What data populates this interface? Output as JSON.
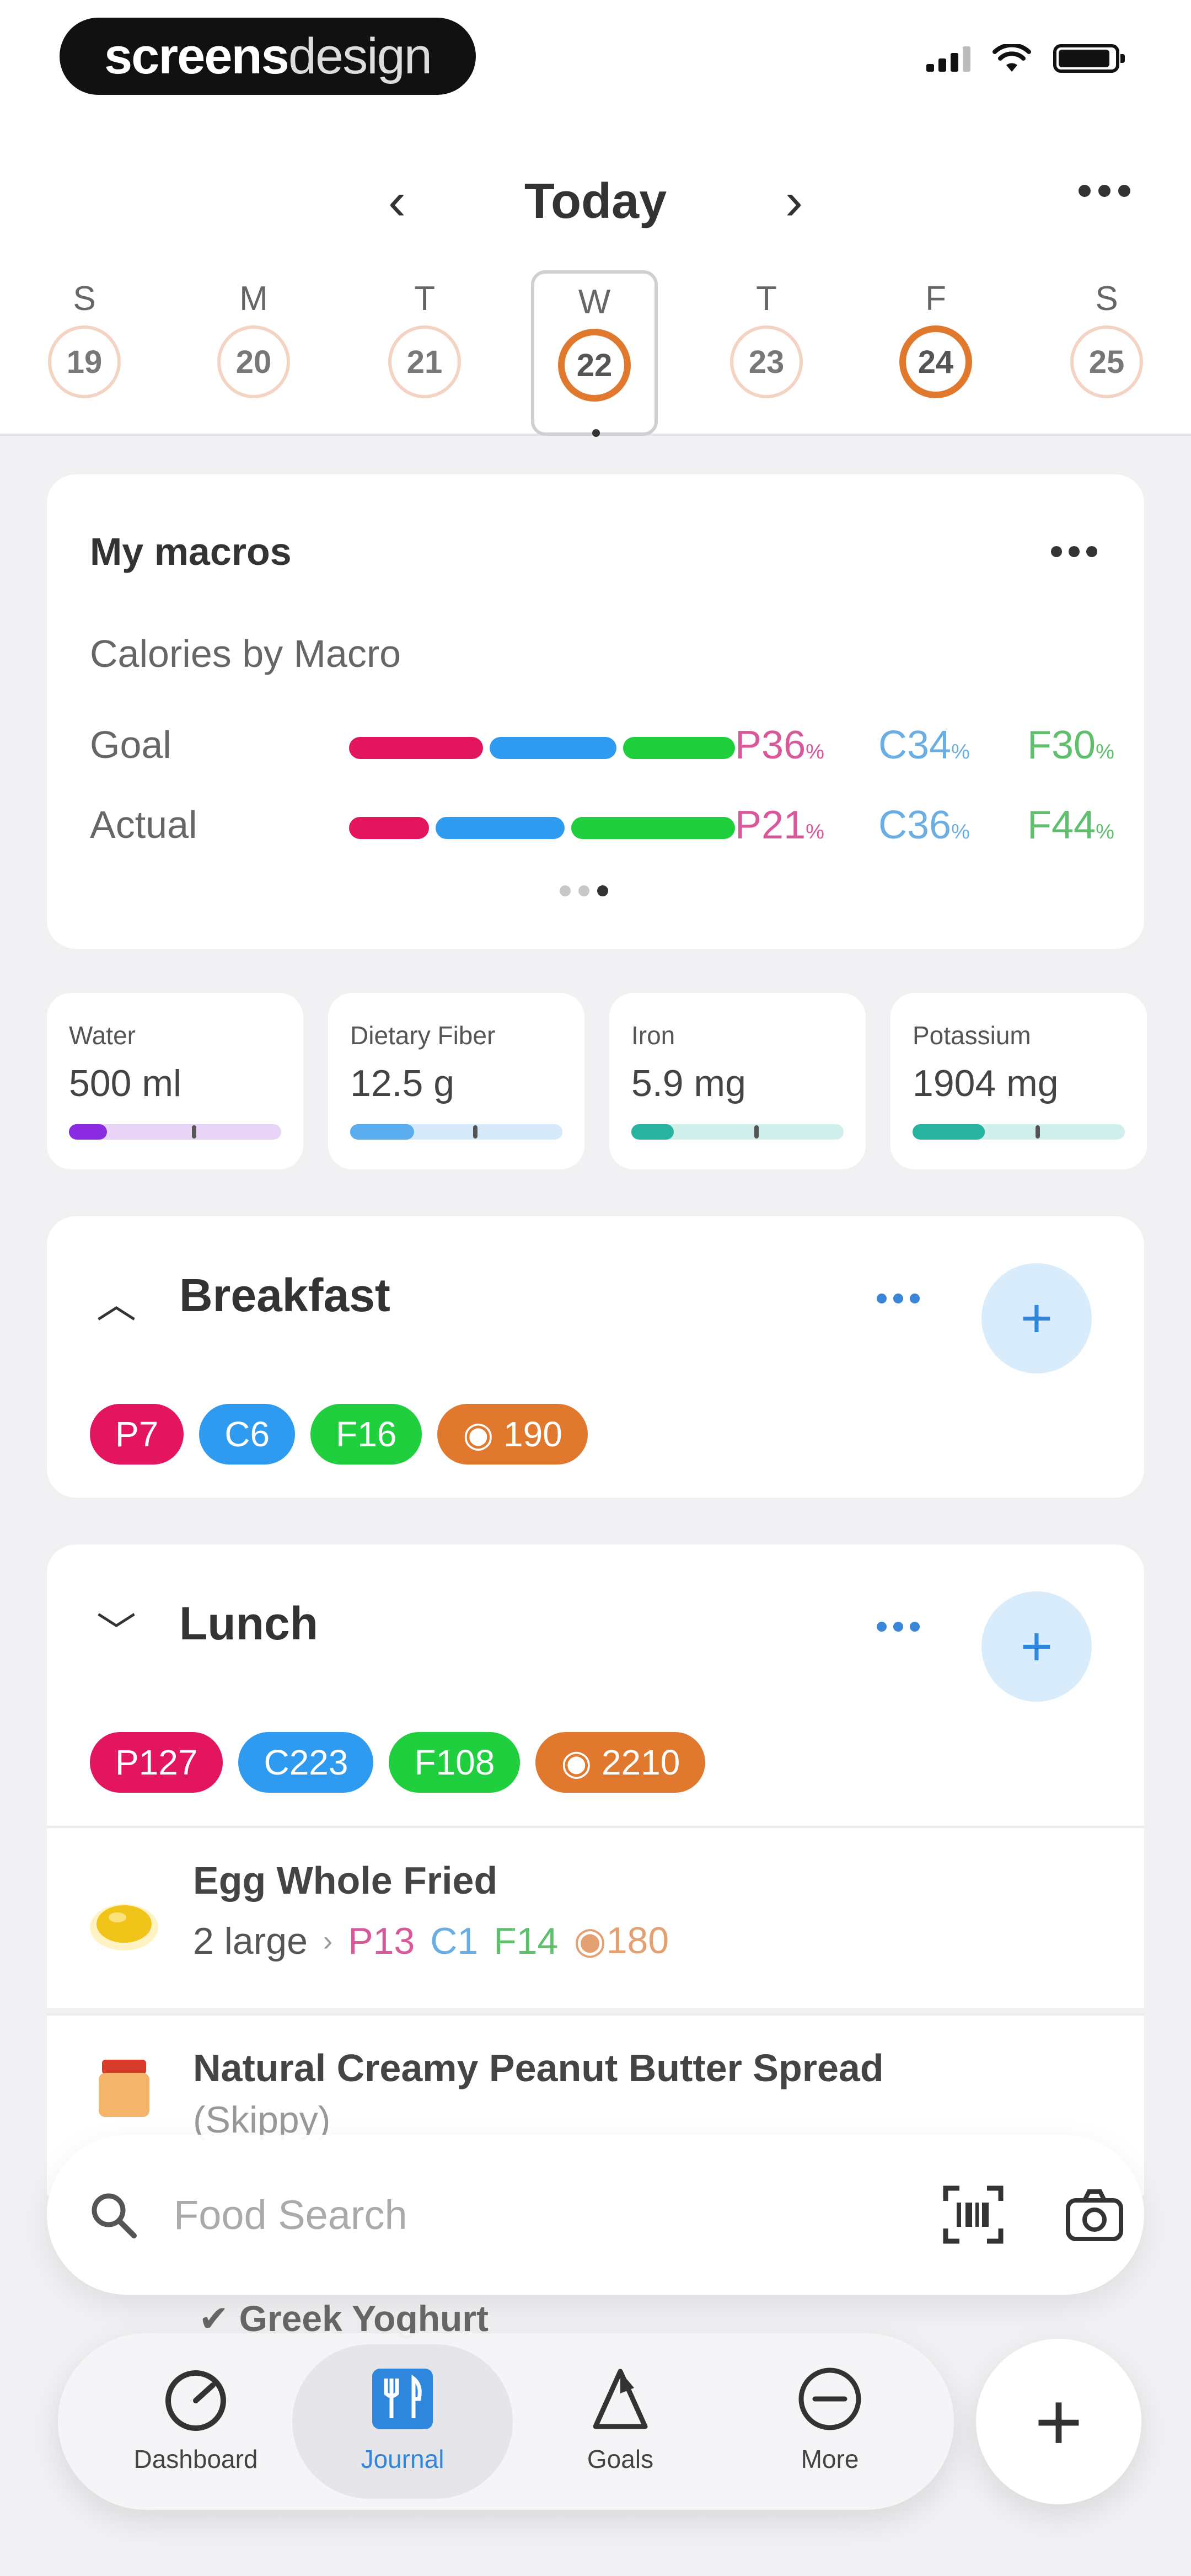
{
  "status_bar": {
    "logo_main": "screens",
    "logo_secondary": "design"
  },
  "header": {
    "title": "Today",
    "prev_icon": "chevron-left-icon",
    "next_icon": "chevron-right-icon",
    "more_icon": "more-horizontal-icon"
  },
  "week": [
    {
      "letter": "S",
      "date": "19"
    },
    {
      "letter": "M",
      "date": "20"
    },
    {
      "letter": "T",
      "date": "21"
    },
    {
      "letter": "W",
      "date": "22"
    },
    {
      "letter": "T",
      "date": "23"
    },
    {
      "letter": "F",
      "date": "24"
    },
    {
      "letter": "S",
      "date": "25"
    }
  ],
  "macros": {
    "title": "My macros",
    "subtitle": "Calories by Macro",
    "goal": {
      "label": "Goal",
      "p": "P36",
      "c": "C34",
      "f": "F30",
      "unit": "%",
      "p_val": 36,
      "c_val": 34,
      "f_val": 30
    },
    "actual": {
      "label": "Actual",
      "p": "P21",
      "c": "C36",
      "f": "F44",
      "unit": "%",
      "p_val": 21,
      "c_val": 36,
      "f_val": 44
    },
    "colors": {
      "protein": "#e3155f",
      "carbs": "#2f9bf0",
      "fat": "#1fcf3e",
      "calories": "#e0792e"
    }
  },
  "nutrients": [
    {
      "label": "Water",
      "value": "500 ml",
      "progress": 0.15,
      "color": "#8a2be2",
      "track": "#e8d4f7"
    },
    {
      "label": "Dietary Fiber",
      "value": "12.5 g",
      "progress": 0.3,
      "color": "#5aaef0",
      "track": "#d7eafb"
    },
    {
      "label": "Iron",
      "value": "5.9 mg",
      "progress": 0.2,
      "color": "#27b3a0",
      "track": "#d2f0eb"
    },
    {
      "label": "Potassium",
      "value": "1904 mg",
      "progress": 0.35,
      "color": "#27b3a0",
      "track": "#d2f0eb"
    }
  ],
  "breakfast": {
    "title": "Breakfast",
    "chips": {
      "p": "P7",
      "c": "C6",
      "f": "F16",
      "k": "190"
    }
  },
  "lunch": {
    "title": "Lunch",
    "chips": {
      "p": "P127",
      "c": "C223",
      "f": "F108",
      "k": "2210"
    }
  },
  "foods": [
    {
      "name": "Egg Whole Fried",
      "amount": "2 large",
      "p": "P13",
      "c": "C1",
      "f": "F14",
      "k": "180"
    },
    {
      "name": "Natural Creamy Peanut Butter Spread",
      "amount": "(Skippy)"
    }
  ],
  "search": {
    "placeholder": "Food Search"
  },
  "behind_text": "Greek Yoghurt",
  "tabs": [
    {
      "label": "Dashboard",
      "icon": "dashboard-gauge-icon"
    },
    {
      "label": "Journal",
      "icon": "journal-cutlery-icon"
    },
    {
      "label": "Goals",
      "icon": "goals-flag-icon"
    },
    {
      "label": "More",
      "icon": "more-circle-icon"
    }
  ],
  "fab_icon": "plus-icon"
}
